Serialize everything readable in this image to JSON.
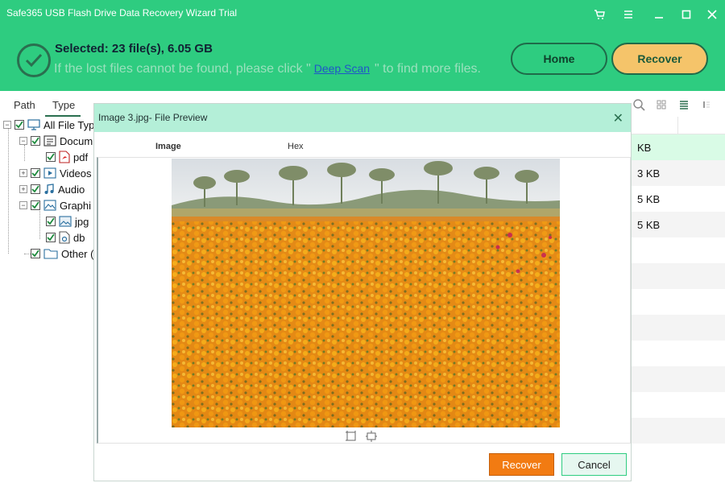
{
  "window": {
    "title": "Safe365 USB Flash Drive Data Recovery Wizard Trial",
    "controls": [
      "cart-icon",
      "menu-icon",
      "minimize-icon",
      "maximize-icon",
      "close-icon"
    ]
  },
  "header": {
    "selected_text": "Selected: 23 file(s), 6.05 GB",
    "hint_prefix": "If the lost files cannot be found, please click \"",
    "deep_scan": "Deep Scan",
    "hint_suffix": "\" to find more files.",
    "home_label": "Home",
    "recover_label": "Recover",
    "colors": {
      "header_bg": "#2ecc80",
      "recover_bg": "#f5c46a",
      "border": "#1f6a49"
    }
  },
  "left_panel": {
    "tabs": [
      {
        "label": "Path"
      },
      {
        "label": "Type"
      }
    ],
    "tree": {
      "all": "All File Typ",
      "documents": "Docum",
      "pdf": "pdf",
      "videos": "Videos",
      "audio": "Audio",
      "graphics": "Graphi",
      "jpg": "jpg",
      "db": "db",
      "other": "Other ("
    }
  },
  "file_list": {
    "rows": [
      {
        "size": "KB"
      },
      {
        "size": "3 KB"
      },
      {
        "size": "5 KB"
      },
      {
        "size": "5 KB"
      }
    ]
  },
  "preview_dialog": {
    "title": "Image 3.jpg- File Preview",
    "tabs": [
      "Image",
      "Hex"
    ],
    "recover_label": "Recover",
    "cancel_label": "Cancel",
    "colors": {
      "title_bg": "#b4efd8",
      "recover_bg": "#f27b12",
      "cancel_border": "#2ecc80"
    }
  }
}
